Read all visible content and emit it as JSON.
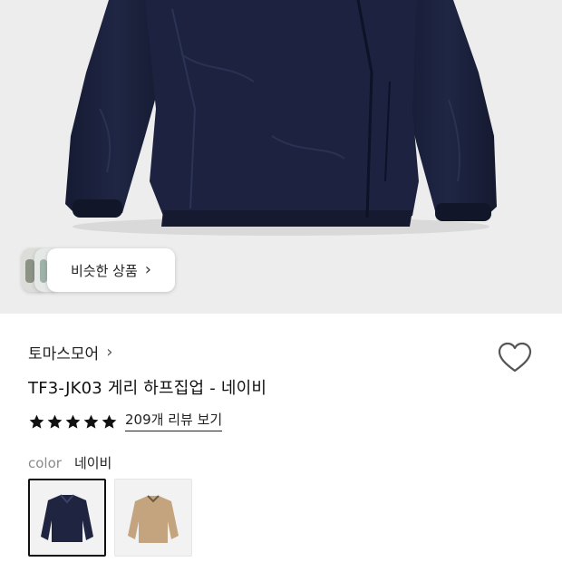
{
  "hero": {
    "similar_button_label": "비슷한 상품",
    "similar_button_icon": "chevron-right-icon",
    "jacket_color": "#1b2140"
  },
  "brand": {
    "name": "토마스모어",
    "chevron": "›"
  },
  "product": {
    "title": "TF3-JK03 게리 하프집업 - 네이비",
    "wishlist_icon": "heart-outline-icon"
  },
  "rating": {
    "stars": 5,
    "star_color": "#111111",
    "review_link": "209개 리뷰 보기"
  },
  "color_option": {
    "label": "color",
    "selected_value": "네이비",
    "swatches": [
      {
        "name": "navy",
        "selected": true,
        "color": "#1f2540"
      },
      {
        "name": "beige",
        "selected": false,
        "color": "#c4a47e"
      }
    ]
  }
}
